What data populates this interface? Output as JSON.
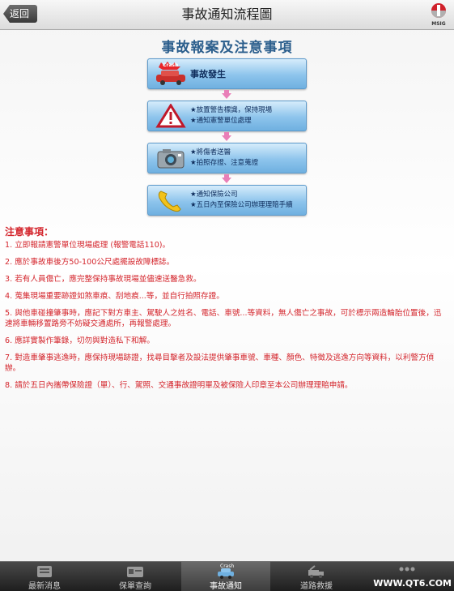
{
  "header": {
    "back_label": "返回",
    "title": "事故通知流程圖",
    "logo_text": "MSIG"
  },
  "main_heading": "事故報案及注意事項",
  "flow": {
    "crash_badge": "Crash",
    "steps": [
      {
        "icon": "crash-car-icon",
        "lines": [
          "事故發生"
        ]
      },
      {
        "icon": "warning-triangle-icon",
        "lines": [
          "★放置警告標識，保持現場",
          "★通知憲警單位處理"
        ]
      },
      {
        "icon": "camera-icon",
        "lines": [
          "★將傷者送醫",
          "★拍照存證、注意蒐證"
        ]
      },
      {
        "icon": "phone-icon",
        "lines": [
          "★通知保險公司",
          "★五日內至保險公司辦理理賠手續"
        ]
      }
    ]
  },
  "notes": {
    "title": "注意事項：",
    "items": [
      "1. 立即報請憲警單位現場處理 (報警電話110)。",
      "2. 應於事故車後方50-100公尺處擺設故障標誌。",
      "3. 若有人員傷亡，應完整保持事故現場並儘速送醫急救。",
      "4. 蒐集現場重要跡證如煞車痕、刮地痕...等，並自行拍照存證。",
      "5. 與他車碰撞肇事時，應記下對方車主、駕駛人之姓名、電話、車號...等資料，無人傷亡之事故，可於標示兩造輪胎位置後，迅速將車輛移置路旁不妨礙交通處所，再報警處理。",
      "6. 應詳實製作筆錄，切勿與對造私下和解。",
      "7. 對造車肇事逃逸時，應保持現場跡證，找尋目擊者及設法提供肇事車號、車種、顏色、特徵及逃逸方向等資料，以利警方偵辦。",
      "8. 請於五日內攜帶保險證（單）、行、駕照、交通事故證明單及被保險人印章至本公司辦理理賠申請。"
    ]
  },
  "tabs": [
    {
      "label": "最新消息",
      "icon": "news-icon"
    },
    {
      "label": "保單查詢",
      "icon": "policy-card-icon"
    },
    {
      "label": "事故通知",
      "icon": "crash-icon",
      "icon_text": "Crash",
      "active": true
    },
    {
      "label": "道路救援",
      "icon": "tow-truck-icon"
    },
    {
      "label": "",
      "icon": "more-dots-icon"
    }
  ],
  "watermark": "WWW.QT6.COM"
}
